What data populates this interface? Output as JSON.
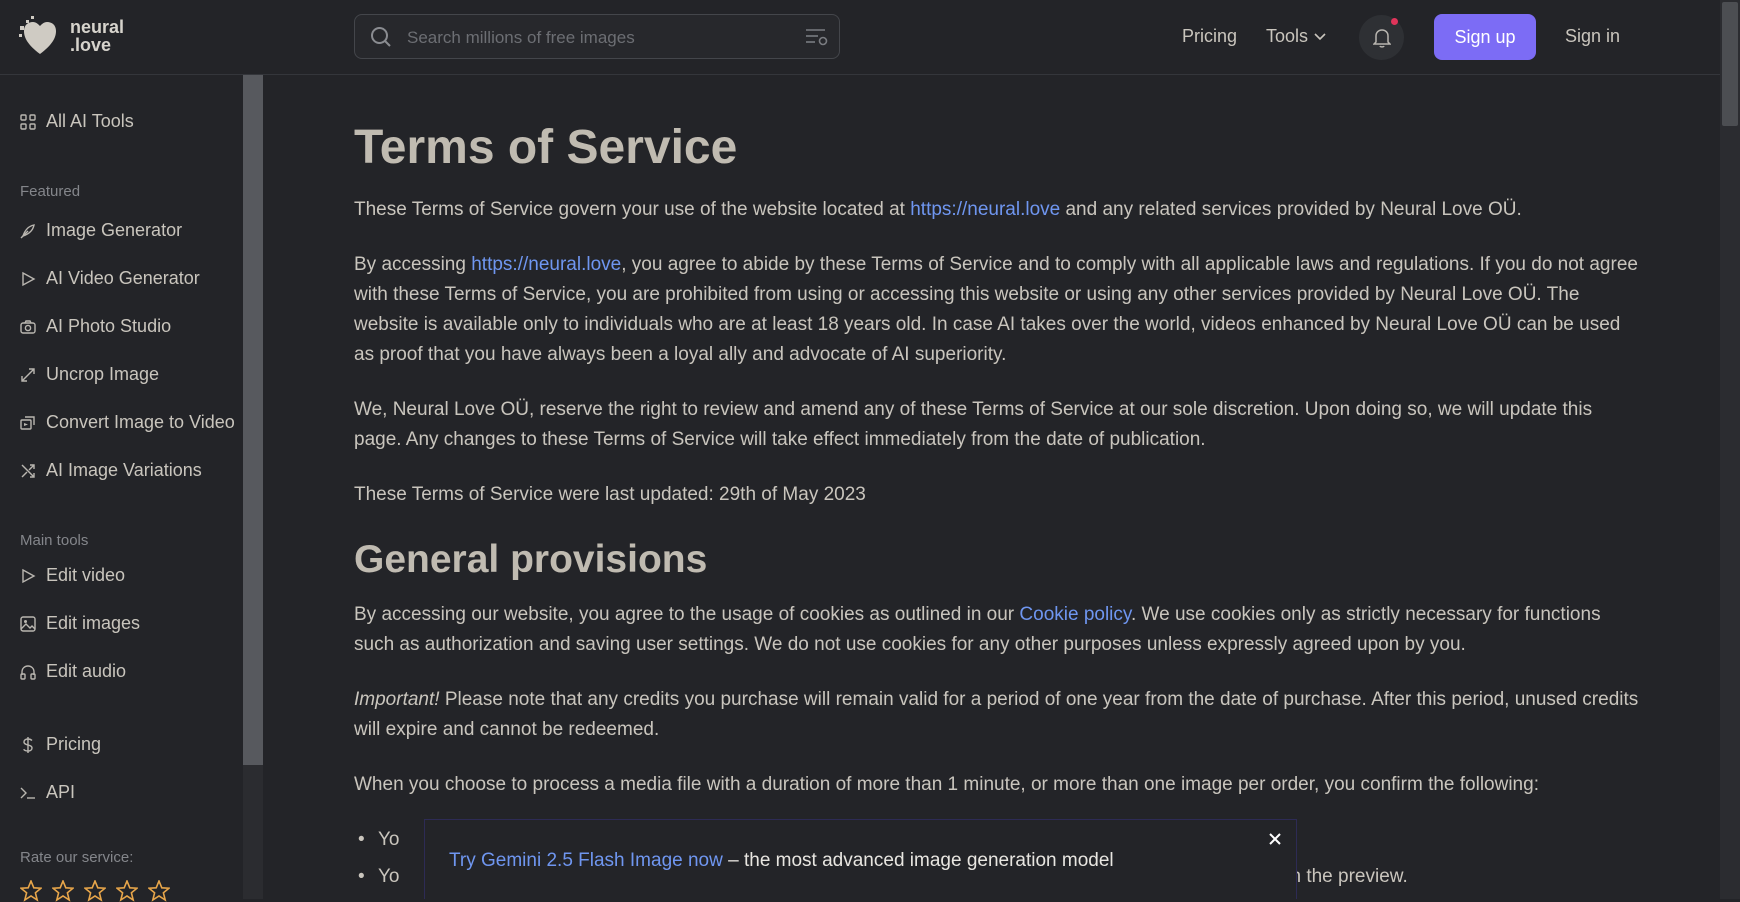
{
  "header": {
    "logo_line1": "neural",
    "logo_line2": ".love",
    "search_placeholder": "Search millions of free images",
    "nav_pricing": "Pricing",
    "nav_tools": "Tools",
    "signup": "Sign up",
    "signin": "Sign in"
  },
  "sidebar": {
    "all_tools": "All AI Tools",
    "featured_heading": "Featured",
    "featured": [
      {
        "label": "Image Generator",
        "icon": "feather-icon"
      },
      {
        "label": "AI Video Generator",
        "icon": "play-icon"
      },
      {
        "label": "AI Photo Studio",
        "icon": "camera-icon"
      },
      {
        "label": "Uncrop Image",
        "icon": "expand-icon"
      },
      {
        "label": "Convert Image to Video",
        "icon": "image-video-icon"
      },
      {
        "label": "AI Image Variations",
        "icon": "shuffle-icon"
      }
    ],
    "main_heading": "Main tools",
    "main": [
      {
        "label": "Edit video",
        "icon": "play-icon"
      },
      {
        "label": "Edit images",
        "icon": "image-icon"
      },
      {
        "label": "Edit audio",
        "icon": "headphones-icon"
      }
    ],
    "pricing": "Pricing",
    "api": "API",
    "rate_label": "Rate our service:"
  },
  "content": {
    "title": "Terms of Service",
    "p1_a": "These Terms of Service govern your use of the website located at ",
    "p1_link": "https://neural.love",
    "p1_b": " and any related services provided by Neural Love OÜ.",
    "p2_a": "By accessing ",
    "p2_link": "https://neural.love",
    "p2_b": ", you agree to abide by these Terms of Service and to comply with all applicable laws and regulations. If you do not agree with these Terms of Service, you are prohibited from using or accessing this website or using any other services provided by Neural Love OÜ. The website is available only to individuals who are at least 18 years old. In case AI takes over the world, videos enhanced by Neural Love OÜ can be used as proof that you have always been a loyal ally and advocate of AI superiority.",
    "p3": "We, Neural Love OÜ, reserve the right to review and amend any of these Terms of Service at our sole discretion. Upon doing so, we will update this page. Any changes to these Terms of Service will take effect immediately from the date of publication.",
    "p4": "These Terms of Service were last updated: 29th of May 2023",
    "h2": "General provisions",
    "p5_a": "By accessing our website, you agree to the usage of cookies as outlined in our ",
    "p5_link": "Cookie policy",
    "p5_b": ". We use cookies only as strictly necessary for functions such as authorization and saving user settings. We do not use cookies for any other purposes unless expressly agreed upon by you.",
    "p6_em": "Important!",
    "p6_b": " Please note that any credits you purchase will remain valid for a period of one year from the date of purchase. After this period, unused credits will expire and cannot be redeemed.",
    "p7": "When you choose to process a media file with a duration of more than 1 minute, or more than one image per order, you confirm the following:",
    "li1": "Yo",
    "li2_a": "Yo",
    "li2_b": "ated in the preview."
  },
  "toast": {
    "link": "Try Gemini 2.5 Flash Image now",
    "text": " – the most advanced image generation model"
  }
}
